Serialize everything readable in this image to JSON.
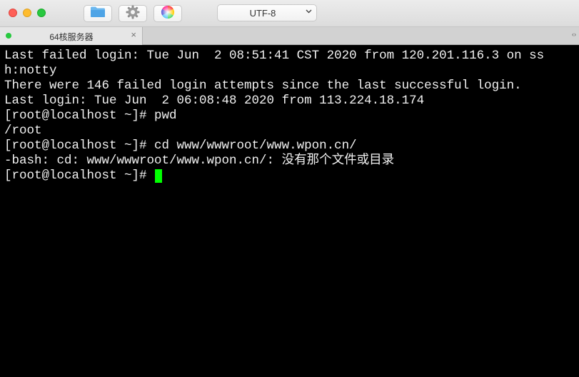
{
  "toolbar": {
    "encoding": "UTF-8",
    "buttons": [
      "folder-icon",
      "gear-icon",
      "color-wheel-icon"
    ]
  },
  "tab": {
    "title": "64核服务器",
    "close": "×"
  },
  "tabbar_arrows": "‹›",
  "terminal": {
    "lines": [
      "Last failed login: Tue Jun  2 08:51:41 CST 2020 from 120.201.116.3 on ss",
      "h:notty",
      "There were 146 failed login attempts since the last successful login.",
      "Last login: Tue Jun  2 06:08:48 2020 from 113.224.18.174",
      "[root@localhost ~]# pwd",
      "/root",
      "[root@localhost ~]# cd www/wwwroot/www.wpon.cn/",
      "-bash: cd: www/wwwroot/www.wpon.cn/: 没有那个文件或目录"
    ],
    "prompt": "[root@localhost ~]#"
  },
  "colors": {
    "background": "#000000",
    "foreground": "#f2f2f2",
    "cursor": "#00ff00",
    "tab_dot": "#27c93f"
  }
}
